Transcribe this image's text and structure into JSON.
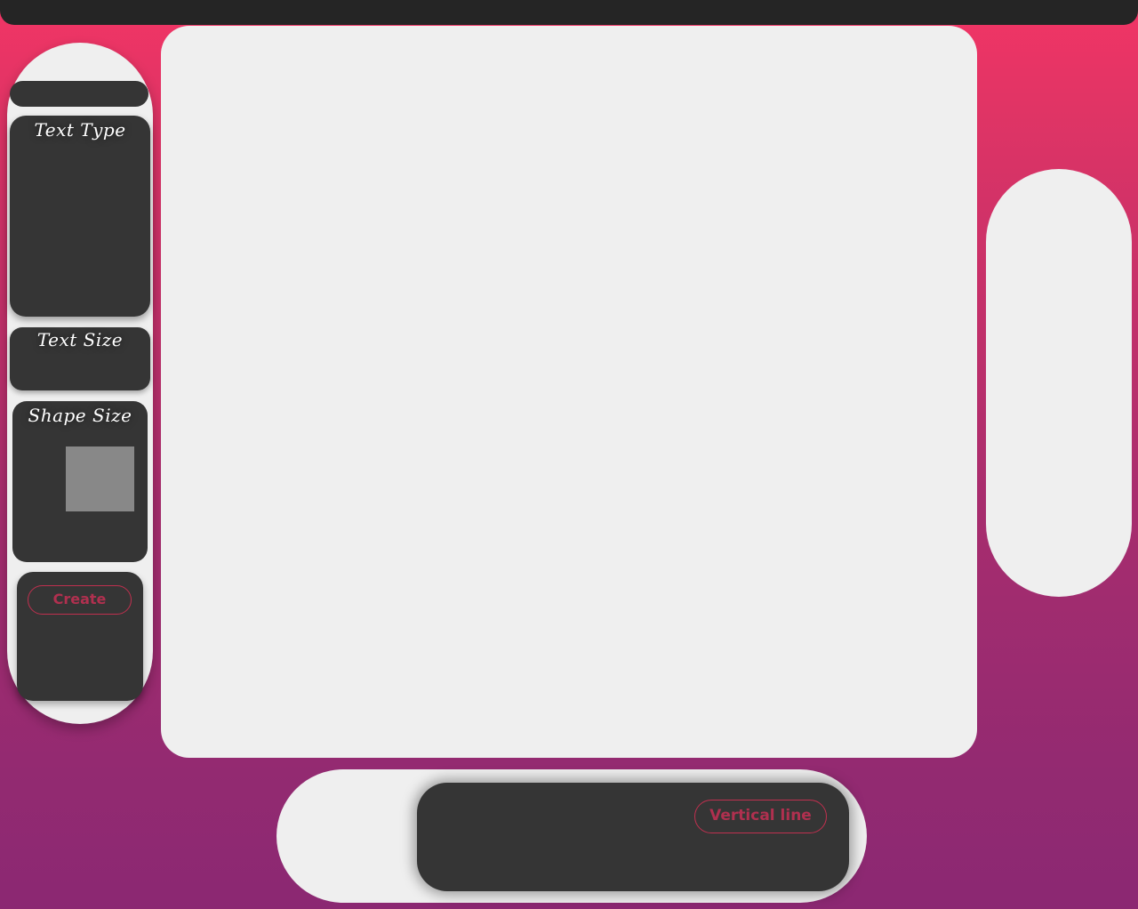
{
  "left_panel": {
    "text_type": {
      "title": "Text Type"
    },
    "text_size": {
      "title": "Text Size"
    },
    "shape_size": {
      "title": "Shape Size"
    },
    "create": {
      "label": "Create"
    }
  },
  "bottom_panel": {
    "vertical_line": {
      "label": "Vertical line"
    }
  },
  "colors": {
    "background_top": "#f23565",
    "background_bottom": "#8b2872",
    "panel": "#efefef",
    "card": "#353535",
    "accent": "#c0304f",
    "shape_preview": "#888888"
  }
}
